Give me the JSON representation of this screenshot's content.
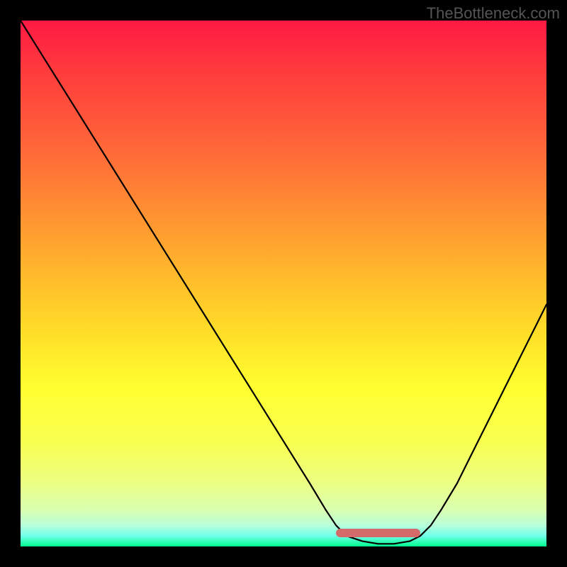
{
  "watermark": "TheBottleneck.com",
  "chart_data": {
    "type": "line",
    "title": "",
    "xlabel": "",
    "ylabel": "",
    "xlim": [
      0,
      100
    ],
    "ylim": [
      0,
      100
    ],
    "description": "Bottleneck curve over rainbow gradient background. Curve descends from top-left, reaches a flat minimum around x≈62–74, then rises toward the right. A salmon-colored highlight marks the flat optimal region at the bottom of the valley.",
    "series": [
      {
        "name": "bottleneck-curve",
        "x": [
          0,
          5,
          10,
          15,
          20,
          25,
          30,
          35,
          40,
          45,
          50,
          55,
          58,
          60,
          62,
          65,
          68,
          71,
          74,
          76,
          78,
          80,
          83,
          86,
          89,
          92,
          95,
          98,
          100
        ],
        "values": [
          100,
          92,
          84,
          76,
          68,
          60,
          52,
          44,
          36,
          28,
          20,
          12,
          7,
          4,
          2,
          1,
          0.5,
          0.5,
          1,
          2,
          4,
          7,
          12,
          18,
          24,
          30,
          36,
          42,
          46
        ]
      }
    ],
    "highlight_region": {
      "x_start": 60,
      "x_end": 76,
      "y": 2.5
    }
  }
}
